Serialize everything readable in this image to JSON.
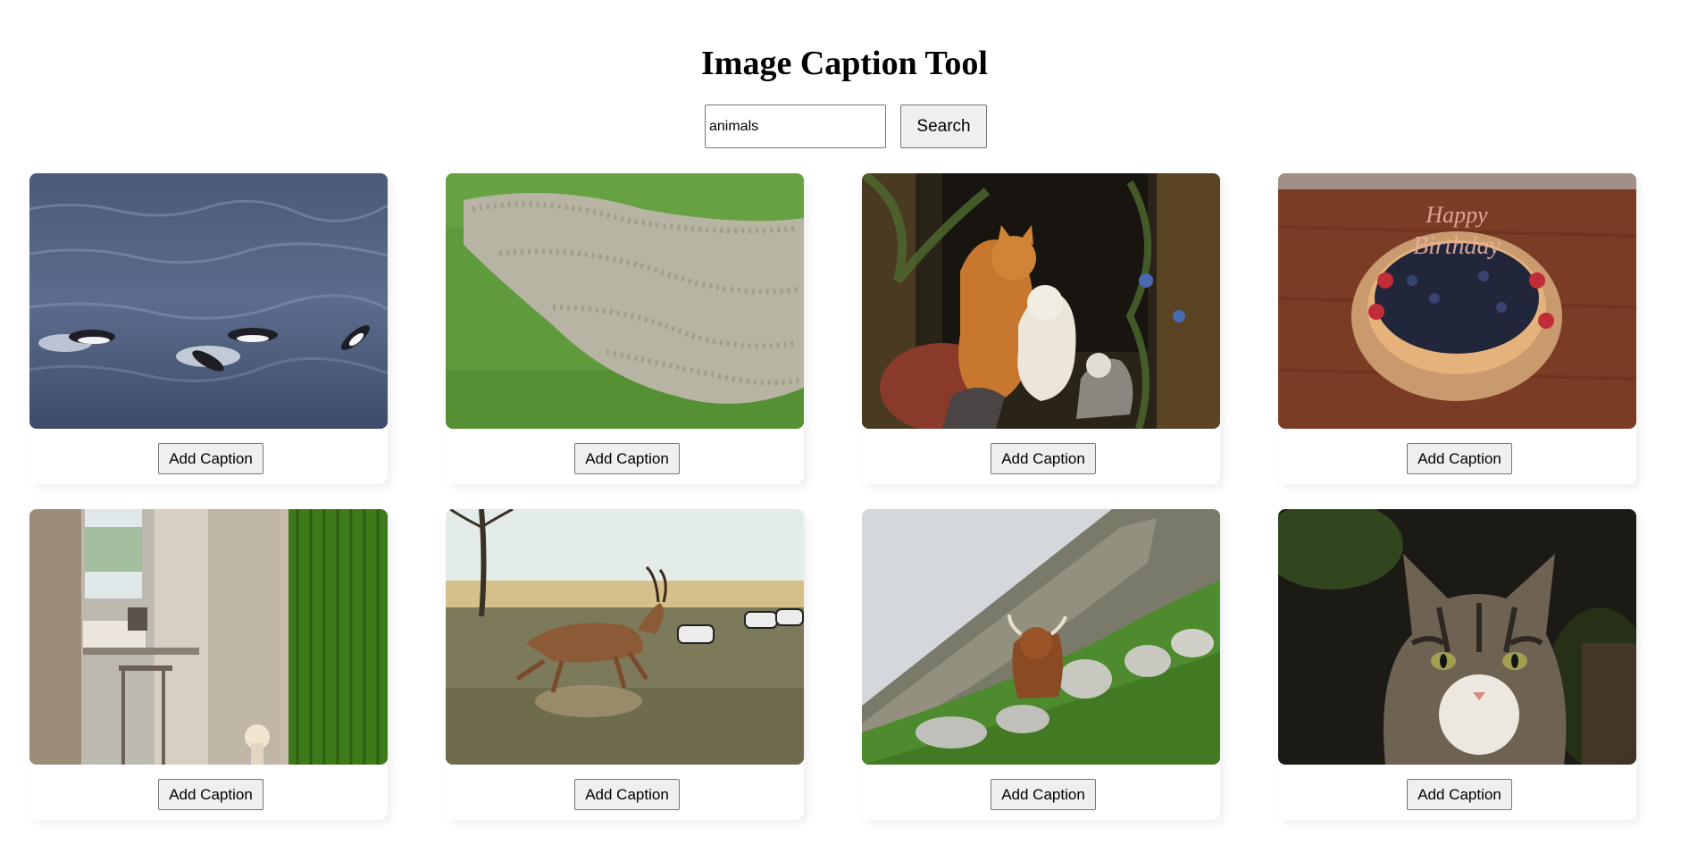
{
  "header": {
    "title": "Image Caption Tool"
  },
  "search": {
    "value": "animals",
    "button_label": "Search"
  },
  "cards": [
    {
      "image": "penguins-swimming-in-ocean",
      "button_label": "Add Caption"
    },
    {
      "image": "sheep-flock-on-green-field",
      "button_label": "Add Caption"
    },
    {
      "image": "cats-painting-with-kittens",
      "button_label": "Add Caption"
    },
    {
      "image": "birthday-blueberry-cake",
      "button_label": "Add Caption"
    },
    {
      "image": "kitchen-interior-with-green-curtain",
      "button_label": "Add Caption"
    },
    {
      "image": "antelope-running-with-zebras",
      "button_label": "Add Caption"
    },
    {
      "image": "highland-cow-on-rocky-hillside",
      "button_label": "Add Caption"
    },
    {
      "image": "tabby-kitten-portrait",
      "button_label": "Add Caption"
    }
  ]
}
